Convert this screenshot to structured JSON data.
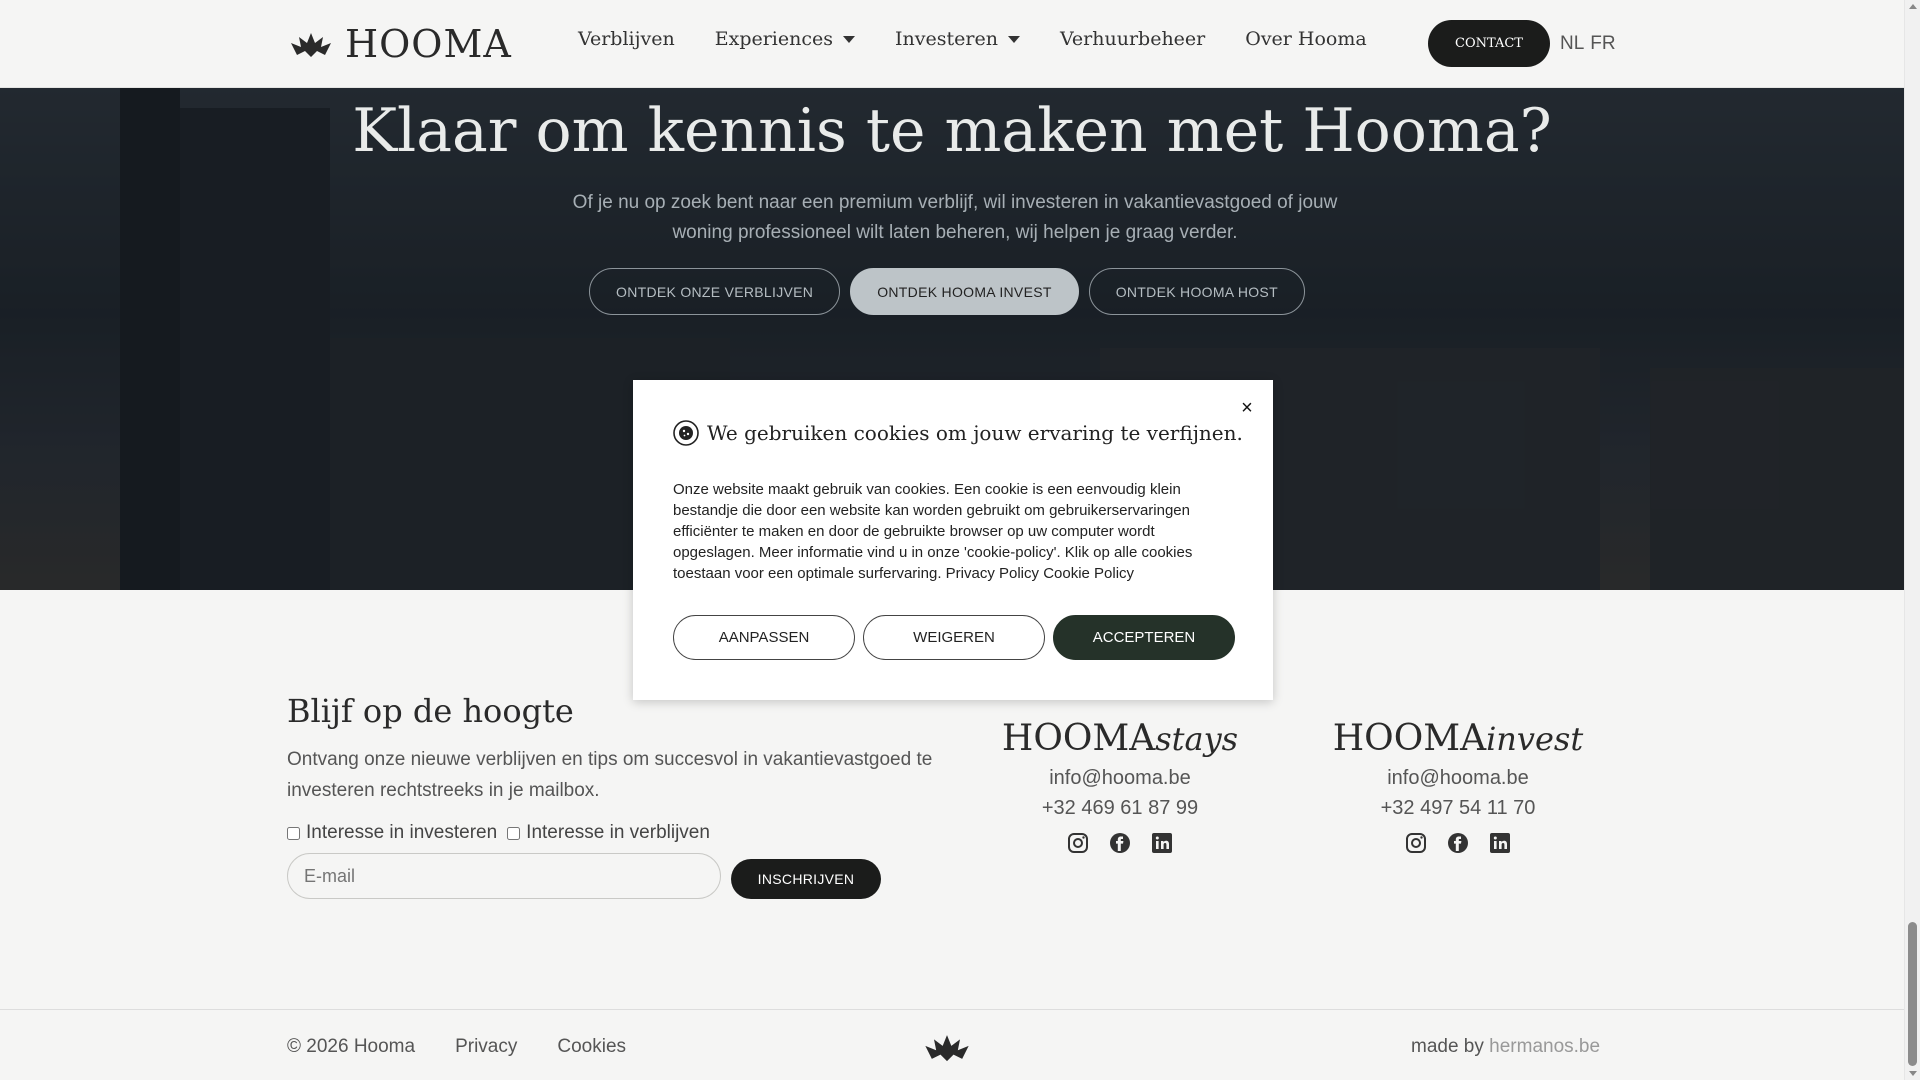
{
  "header": {
    "logo_text": "HOOMA",
    "nav": [
      {
        "label": "Verblijven",
        "dropdown": false
      },
      {
        "label": "Experiences",
        "dropdown": true
      },
      {
        "label": "Investeren",
        "dropdown": true
      },
      {
        "label": "Verhuurbeheer",
        "dropdown": false
      },
      {
        "label": "Over Hooma",
        "dropdown": false
      }
    ],
    "contact_label": "CONTACT",
    "lang_nl": "NL",
    "lang_fr": "FR"
  },
  "hero": {
    "title": "Klaar om kennis te maken met Hooma?",
    "subtitle": "Of je nu op zoek bent naar een premium verblijf, wil investeren in vakantievastgoed of jouw woning professioneel wilt laten beheren, wij helpen je graag verder.",
    "buttons": [
      "ONTDEK ONZE VERBLIJVEN",
      "ONTDEK HOOMA INVEST",
      "ONTDEK HOOMA HOST"
    ]
  },
  "newsletter": {
    "title": "Blijf op de hoogte",
    "text": "Ontvang onze nieuwe verblijven en tips om succesvol in vakantievastgoed te investeren rechtstreeks in je mailbox.",
    "check_invest": "Interesse in investeren",
    "check_stay": "Interesse in verblijven",
    "email_placeholder": "E-mail",
    "subscribe_label": "INSCHRIJVEN"
  },
  "brands": {
    "stays": {
      "name": "HOOMA",
      "suffix": "stays",
      "email": "info@hooma.be",
      "phone": "+32 469 61 87 99"
    },
    "invest": {
      "name": "HOOMA",
      "suffix": "invest",
      "email": "info@hooma.be",
      "phone": "+32 497 54 11 70"
    }
  },
  "footer": {
    "copyright": "© 2026 Hooma",
    "privacy": "Privacy",
    "cookies": "Cookies",
    "made_by": "made by",
    "made_by_link": "hermanos.be"
  },
  "cookie_modal": {
    "title": "We gebruiken cookies om jouw ervaring te verfijnen.",
    "body": "Onze website maakt gebruik van cookies. Een cookie is een eenvoudig klein bestandje die door een website kan worden gebruikt om gebruikerservaringen efficiënter te maken en door de gebruikte browser op uw computer wordt opgeslagen. Meer informatie vind u in onze 'cookie-policy'. Klik op alle cookies toestaan voor een optimale surfervaring.",
    "privacy_link": "Privacy Policy",
    "cookie_link": "Cookie Policy",
    "btn_customize": "AANPASSEN",
    "btn_refuse": "WEIGEREN",
    "btn_accept": "ACCEPTEREN",
    "close_symbol": "×"
  }
}
